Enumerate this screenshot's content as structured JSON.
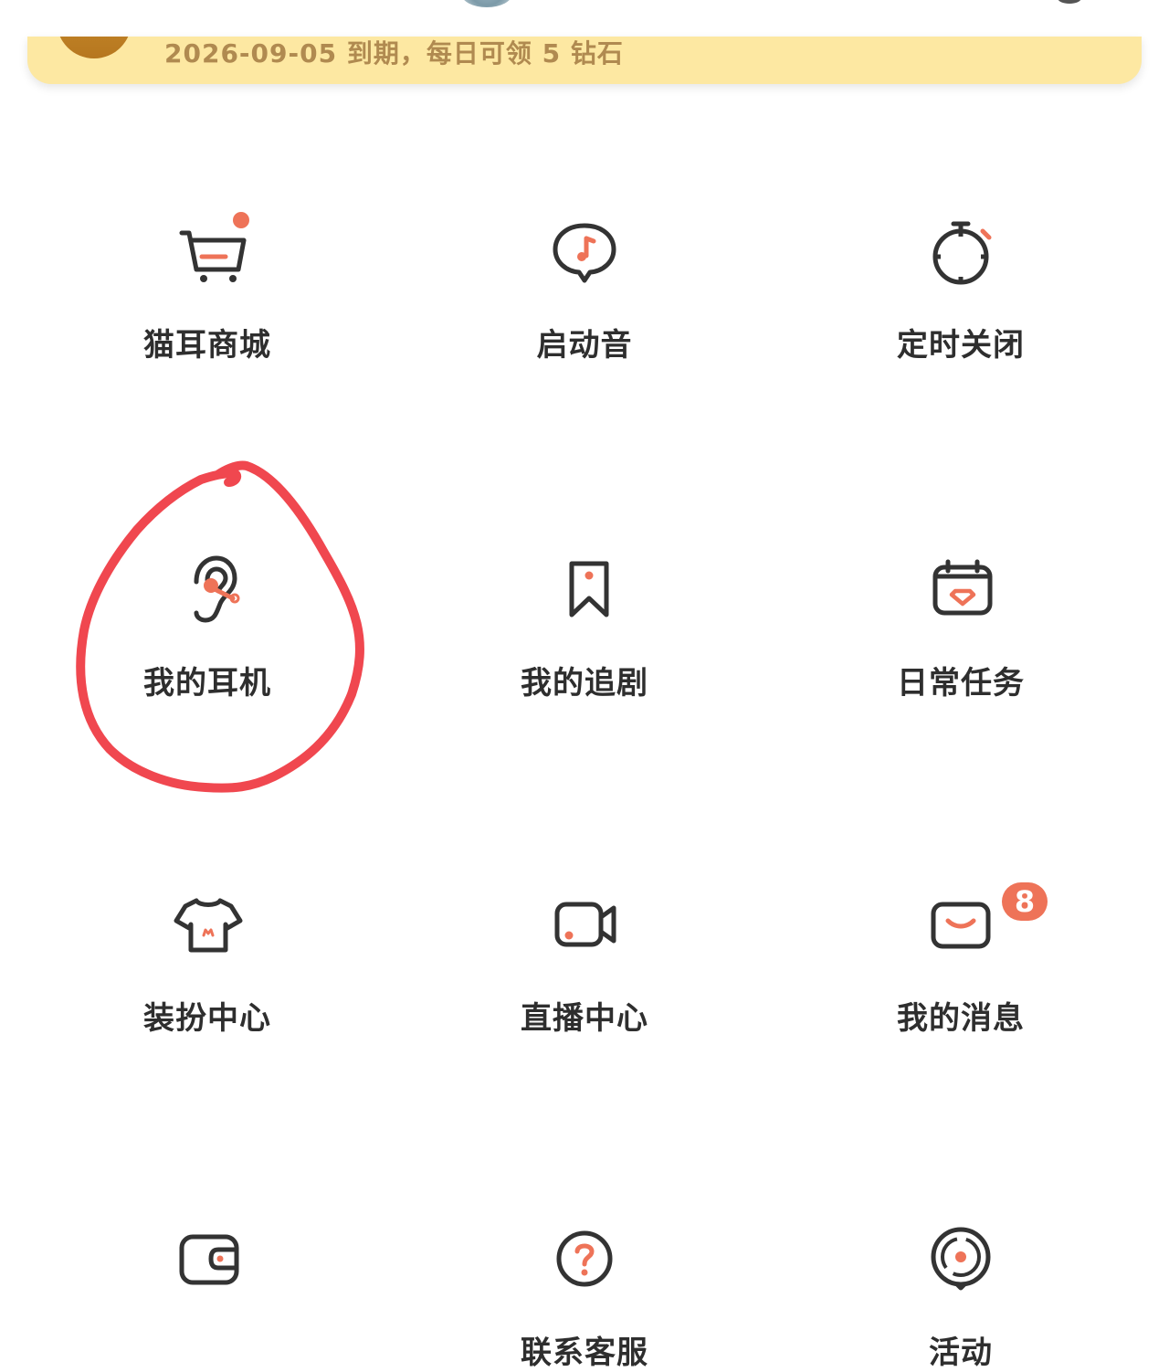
{
  "vip_banner": {
    "text": "2026-09-05 到期，每日可领 5 钻石"
  },
  "menu": {
    "shop": {
      "label": "猫耳商城",
      "icon": "shopping-cart-icon"
    },
    "startup_sound": {
      "label": "启动音",
      "icon": "music-bubble-icon"
    },
    "timer_close": {
      "label": "定时关闭",
      "icon": "stopwatch-icon"
    },
    "my_earphones": {
      "label": "我的耳机",
      "icon": "ear-icon"
    },
    "my_dramas": {
      "label": "我的追剧",
      "icon": "bookmark-icon"
    },
    "daily_tasks": {
      "label": "日常任务",
      "icon": "calendar-diamond-icon"
    },
    "dress_center": {
      "label": "装扮中心",
      "icon": "tshirt-icon"
    },
    "live_center": {
      "label": "直播中心",
      "icon": "video-camera-icon"
    },
    "my_messages": {
      "label": "我的消息",
      "icon": "envelope-icon",
      "badge": "8"
    },
    "wallet": {
      "label": "",
      "icon": "wallet-icon"
    },
    "customer_service": {
      "label": "联系客服",
      "icon": "question-circle-icon"
    },
    "activities": {
      "label": "活动",
      "icon": "target-circle-icon"
    }
  },
  "colors": {
    "accent": "#ee7358",
    "icon_stroke": "#333333",
    "banner_bg": "#fde8a2",
    "banner_text": "#b08a50",
    "annotation": "#f0474f"
  }
}
